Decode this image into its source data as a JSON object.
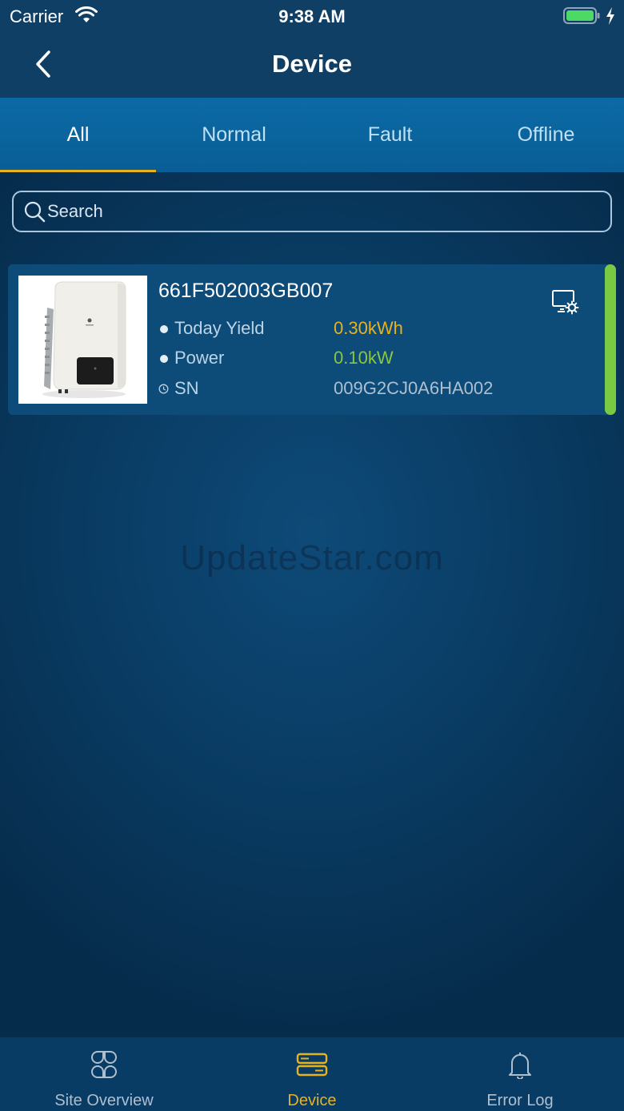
{
  "status_bar": {
    "carrier": "Carrier",
    "time": "9:38 AM",
    "battery_color": "#4cd964"
  },
  "nav": {
    "title": "Device",
    "back_icon": "chevron-left-icon"
  },
  "tabs": [
    {
      "label": "All",
      "active": true
    },
    {
      "label": "Normal",
      "active": false
    },
    {
      "label": "Fault",
      "active": false
    },
    {
      "label": "Offline",
      "active": false
    }
  ],
  "search": {
    "placeholder": "Search",
    "value": ""
  },
  "devices": [
    {
      "name": "661F502003GB007",
      "status_color": "#7ac943",
      "rows": [
        {
          "label": "Today Yield",
          "value": "0.30kWh",
          "value_color": "#e8b21e"
        },
        {
          "label": "Power",
          "value": "0.10kW",
          "value_color": "#8cc63f"
        },
        {
          "label": "SN",
          "value": "009G2CJ0A6HA002",
          "value_color": "#aebfcf"
        }
      ]
    }
  ],
  "watermark": "UpdateStar.com",
  "bottom_tabs": [
    {
      "label": "Site Overview",
      "icon": "site-overview-icon",
      "active": false
    },
    {
      "label": "Device",
      "icon": "device-icon",
      "active": true
    },
    {
      "label": "Error Log",
      "icon": "bell-icon",
      "active": false
    }
  ],
  "colors": {
    "accent": "#e8b21e",
    "header": "#103f66",
    "tab_bar": "#0b6aa6",
    "card": "#0d4b79"
  }
}
